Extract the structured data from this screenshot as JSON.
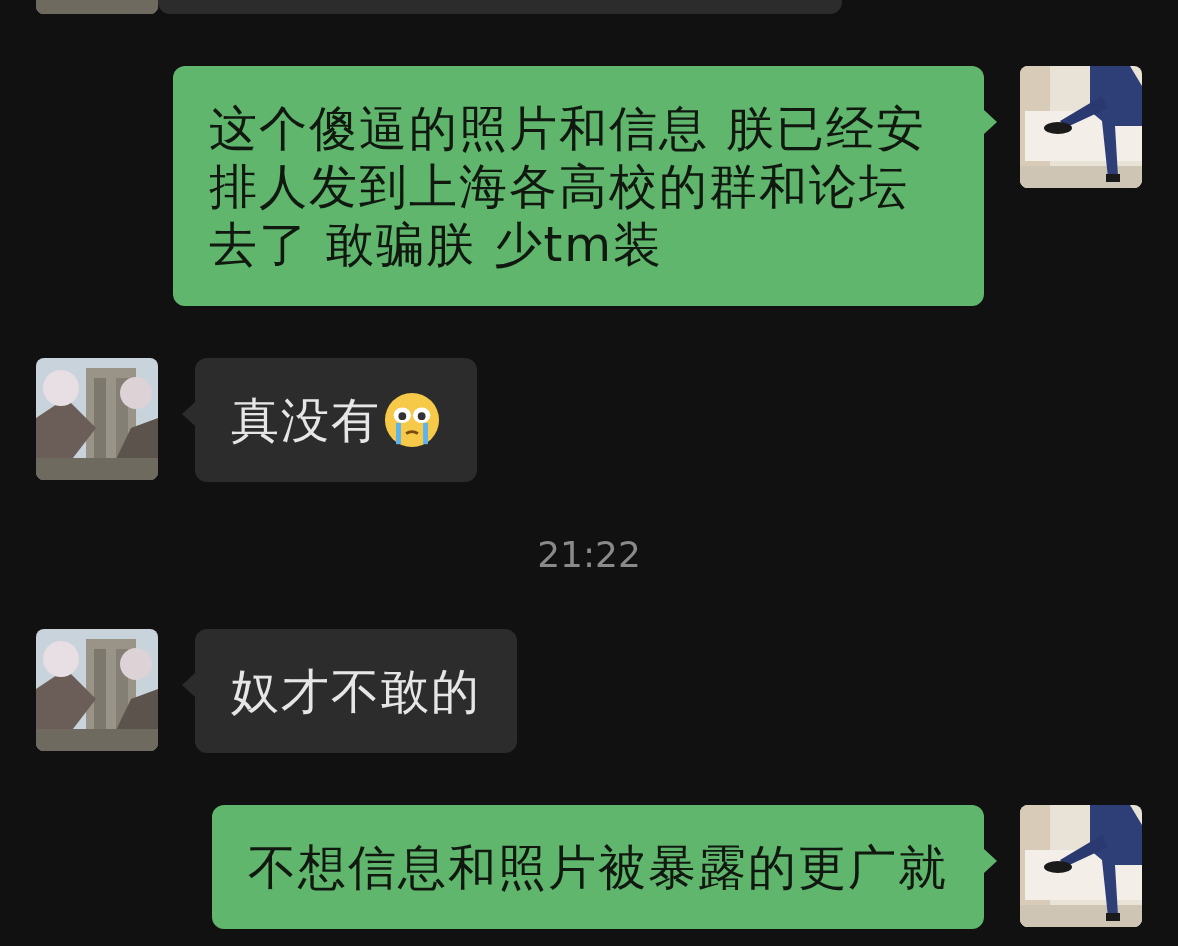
{
  "messages": [
    {
      "kind": "received",
      "partial": true
    },
    {
      "kind": "sent",
      "text": "这个傻逼的照片和信息 朕已经安排人发到上海各高校的群和论坛去了 敢骗朕 少tm装"
    },
    {
      "kind": "received_crying",
      "text": "真没有"
    },
    {
      "kind": "time",
      "text": "21:22"
    },
    {
      "kind": "received",
      "text": "奴才不敢的"
    },
    {
      "kind": "sent",
      "text": "不想信息和照片被暴露的更广就"
    }
  ]
}
